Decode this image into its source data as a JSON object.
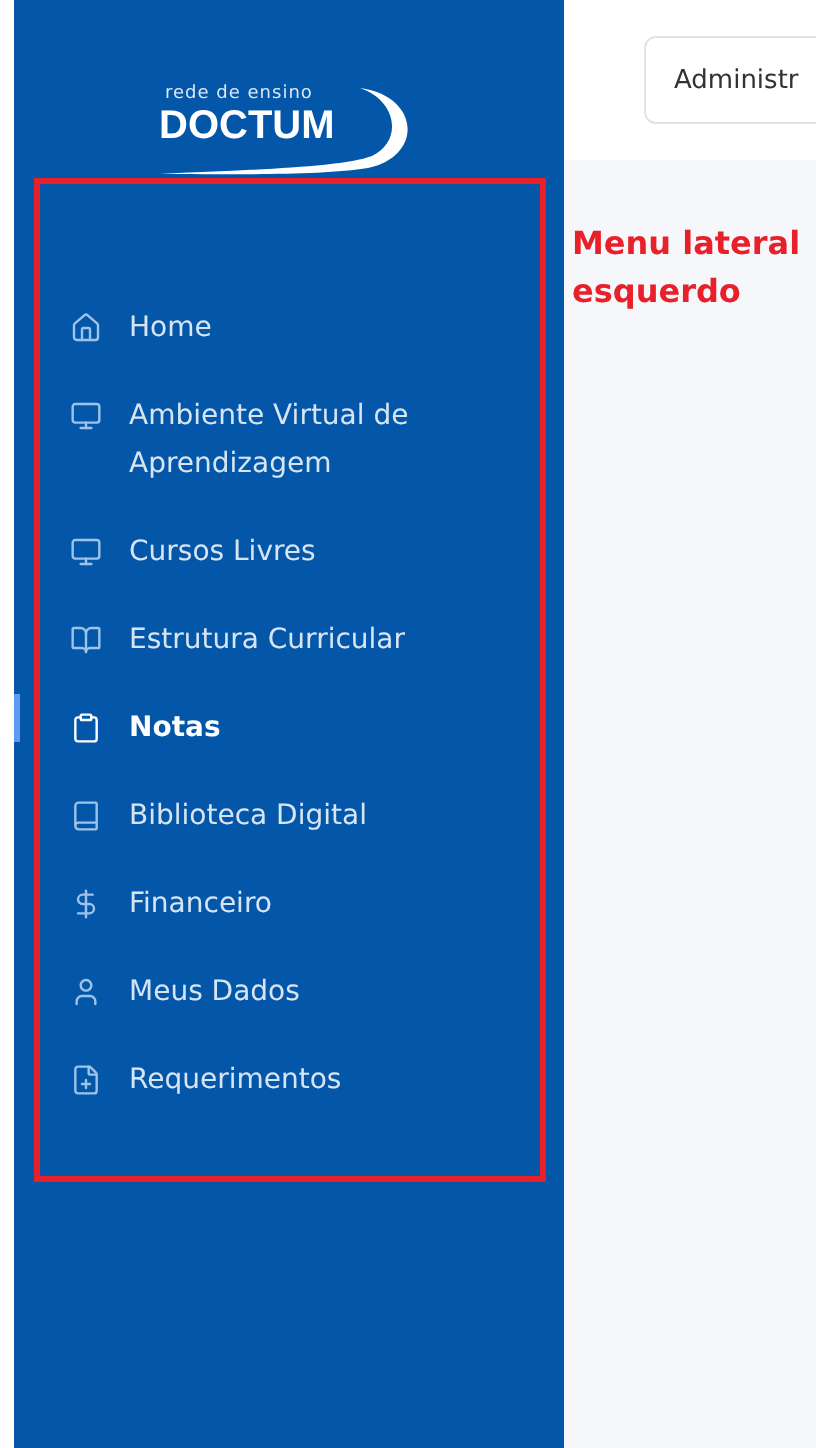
{
  "logo": {
    "tagline": "rede de ensino",
    "name": "DOCTUM"
  },
  "sidebar": {
    "items": [
      {
        "kind": "home",
        "label": "Home",
        "selected": false
      },
      {
        "kind": "monitor",
        "label": "Ambiente Virtual de Aprendizagem",
        "selected": false
      },
      {
        "kind": "monitor",
        "label": "Cursos Livres",
        "selected": false
      },
      {
        "kind": "book-open",
        "label": "Estrutura Curricular",
        "selected": false
      },
      {
        "kind": "clipboard",
        "label": "Notas",
        "selected": true
      },
      {
        "kind": "book",
        "label": "Biblioteca Digital",
        "selected": false
      },
      {
        "kind": "dollar",
        "label": "Financeiro",
        "selected": false
      },
      {
        "kind": "user",
        "label": "Meus Dados",
        "selected": false
      },
      {
        "kind": "file-plus",
        "label": "Requerimentos",
        "selected": false
      }
    ]
  },
  "header": {
    "profile_select": "Administr"
  },
  "annotation": {
    "text": "Menu lateral esquerdo"
  }
}
